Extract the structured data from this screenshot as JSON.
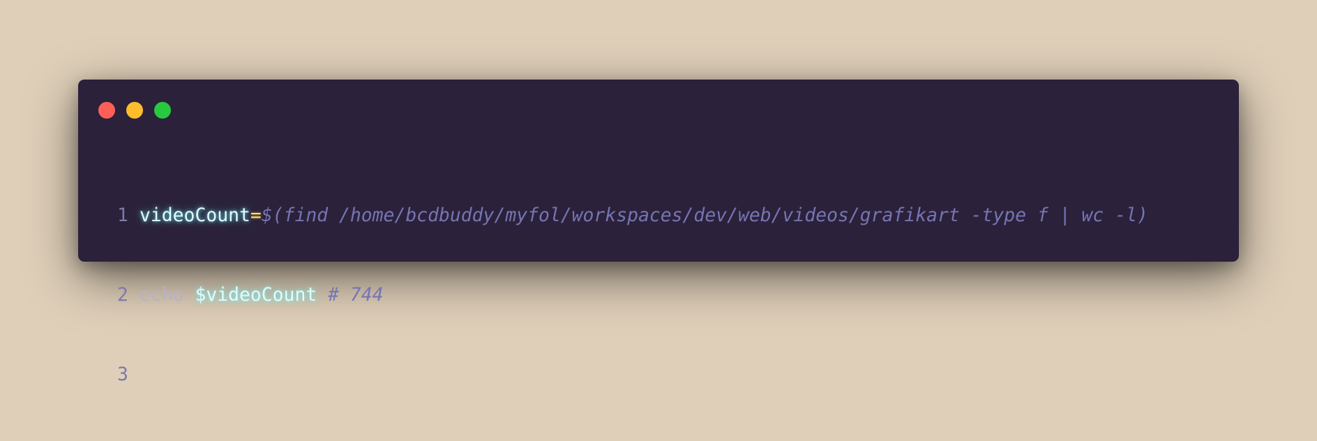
{
  "window": {
    "buttons": [
      {
        "name": "close",
        "color": "#ff5f56"
      },
      {
        "name": "minimize",
        "color": "#ffbd2e"
      },
      {
        "name": "zoom",
        "color": "#27c93f"
      }
    ]
  },
  "code": {
    "lines": [
      {
        "number": "1",
        "tokens": {
          "var": "videoCount",
          "op": "=",
          "sub": "$(find /home/bcdbuddy/myfol/workspaces/dev/web/videos/grafikart -type f | wc -l)"
        }
      },
      {
        "number": "2",
        "tokens": {
          "cmd": "echo ",
          "var": "$videoCount",
          "comment": " # 744"
        }
      },
      {
        "number": "3"
      }
    ]
  },
  "colors": {
    "background": "#dfcfb9",
    "window": "#2b213a",
    "line_number": "#7e7aa8",
    "variable": "#dffbff",
    "operator": "#fede5d",
    "subshell": "#7675b3",
    "command": "#b7b2c6"
  }
}
